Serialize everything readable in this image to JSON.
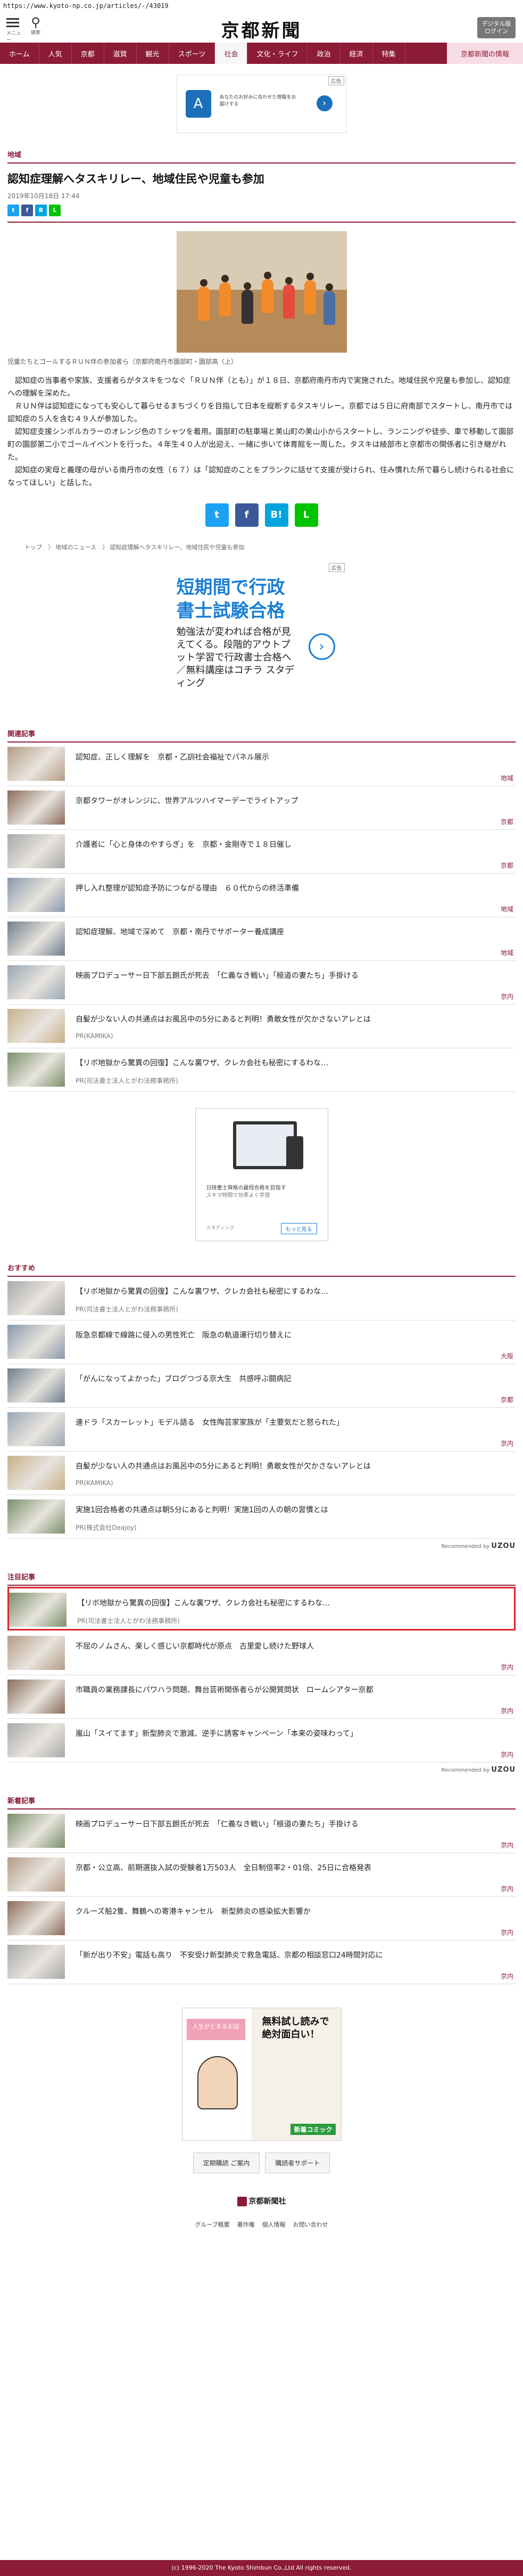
{
  "url": "https://www.kyoto-np.co.jp/articles/-/43019",
  "header": {
    "menu_label": "メニュー",
    "search_label": "検索",
    "logo_text": "京都新聞",
    "download_label_1": "デジタル版",
    "download_label_2": "ログイン"
  },
  "nav": {
    "items": [
      "ホーム",
      "人気",
      "京都",
      "滋賀",
      "観光",
      "スポーツ",
      "社会",
      "文化・ライフ",
      "政治",
      "経済",
      "特集"
    ],
    "active_index": 6,
    "special": "京都新聞の情報"
  },
  "top_ad": {
    "label": "広告",
    "text": "あなたのお好みに合わせた情報をお届けする"
  },
  "article": {
    "section": "地域",
    "headline": "認知症理解へタスキリレー、地域住民や児童も参加",
    "date": "2019年10月18日 17:44",
    "photo_caption": "児童たちとゴールするＲＵＮ伴の参加者ら（京都府南丹市園部町・園部高〈上）",
    "paragraphs": [
      "認知症の当事者や家族、支援者らがタスキをつなぐ「ＲＵＮ伴（とも）」が１８日、京都府南丹市内で実施された。地域住民や児童も参加し、認知症への理解を深めた。",
      "ＲＵＮ伴は認知症になっても安心して暮らせるまちづくりを目指して日本を縦断するタスキリレー。京都では５日に府南部でスタートし、南丹市では認知症の５人を含む４９人が参加した。",
      "認知症支援シンボルカラーのオレンジ色のＴシャツを着用。園部町の駐車場と美山町の美山小からスタートし、ランニングや徒歩、車で移動して園部町の園部第二小でゴールイベントを行った。４年生４０人が出迎え、一緒に歩いて体育館を一周した。タスキは綾部市と京都市の関係者に引き継がれた。",
      "認知症の実母と義理の母がいる南丹市の女性（６７）は「認知症のことをプランクに話せて支援が受けられ、住み慣れた所で暮らし続けられる社会になってほしい」と話した。"
    ]
  },
  "breadcrumb": "トップ　〉 地域のニュース　〉 認知症理解へタスキリレー、地域住民や児童も参加",
  "mid_ad": {
    "label": "広告",
    "headline_1": "短期間で行政",
    "headline_2": "書士試験合格",
    "body": "勉強法が変われば合格が見えてくる。段階的アウトプット学習で行政書士合格へ／無料講座はコチラ スタディング"
  },
  "related": {
    "title": "関連記事",
    "items": [
      {
        "title": "認知症、正しく理解を　京都・乙訓社会福祉でパネル展示",
        "tag": "地域"
      },
      {
        "title": "京都タワーがオレンジに、世界アルツハイマーデーでライトアップ",
        "tag": "京都"
      },
      {
        "title": "介護者に「心と身体のやすらぎ」を　京都・金剛寺で１８日催し",
        "tag": "京都"
      },
      {
        "title": "押し入れ整理が認知症予防につながる理由　６０代からの終活準備",
        "tag": "地域"
      },
      {
        "title": "認知症理解、地域で深めて　京都・南丹でサポーター養成講座",
        "tag": "地域"
      },
      {
        "title": "映画プロデューサー日下部五朗氏が死去　「仁義なき戦い」「極道の妻たち」手掛ける",
        "tag": "京内"
      },
      {
        "title": "自髪が少ない人の共通点はお風呂中の5分にあると判明！勇敢女性が欠かさないアレとは",
        "pr": "PR(KAMIKA)"
      },
      {
        "title": "【リボ地獄から驚異の回復】こんな裏ワザ、クレカ会社も秘密にするわな…",
        "pr": "PR(司法書士法人とがわ法務事務所)"
      }
    ]
  },
  "box_ad": {
    "line1": "日経書士資格の最短合格を目指す",
    "line2": "スキマ時間で効率よく学習",
    "brand": "スタディング",
    "cta": "もっと見る"
  },
  "recommend_list": {
    "title": "おすすめ",
    "items": [
      {
        "title": "【リボ地獄から驚異の回復】こんな裏ワザ、クレカ会社も秘密にするわな…",
        "pr": "PR(司法書士法人とがわ法務事務所)"
      },
      {
        "title": "阪急京都線で線路に侵入の男性死亡　阪急の軌道運行切り替えに",
        "tag": "大阪"
      },
      {
        "title": "「がんになってよかった」ブログつづる京大生　共感呼ぶ闘病記",
        "tag": "京都"
      },
      {
        "title": "連ドラ「スカーレット」モデル語る　女性陶芸家家族が「主要気だと怒られた」",
        "tag": "京内"
      },
      {
        "title": "自髪が少ない人の共通点はお風呂中の5分にあると判明！勇敢女性が欠かさないアレとは",
        "pr": "PR(KAMIKA)"
      },
      {
        "title": "実施1回合格者の共通点は朝5分にあると判明！実施1回の人の朝の習慣とは",
        "pr": "PR(株式会社Deajoy)"
      }
    ],
    "powered_label": "Recommended by",
    "powered_brand": "UZOU"
  },
  "pickup": {
    "title": "注目記事",
    "items": [
      {
        "title": "【リボ地獄から驚異の回復】こんな裏ワザ、クレカ会社も秘密にするわな…",
        "pr": "PR(司法書士法人とがわ法務事務所)"
      },
      {
        "title": "不屈のノムさん、楽しく感じい京都時代が原点　古里愛し続けた野球人",
        "tag": "京内"
      },
      {
        "title": "市職員の業務課長にパワハラ問題、舞台芸術関係者らが公開質問状　ロームシアター京都",
        "tag": "京内"
      },
      {
        "title": "嵐山「スイてます」新型肺炎で激減、逆手に誘客キャンペーン「本来の姿味わって」",
        "tag": "京内"
      }
    ],
    "powered_label": "Recommended by",
    "powered_brand": "UZOU"
  },
  "latest": {
    "title": "新着記事",
    "items": [
      {
        "title": "映画プロデューサー日下部五朗氏が死去　「仁義なき戦い」「極道の妻たち」手掛ける",
        "tag": "京内"
      },
      {
        "title": "京都・公立高、前期選抜入試の受験者1万503人　全日制倍率2・01倍、25日に合格発表",
        "tag": "京内"
      },
      {
        "title": "クルーズ船2隻、舞鶴への寄港キャンセル　新型肺炎の感染拡大影響か",
        "tag": "京内"
      },
      {
        "title": "「新が出り不安」電話も高り　不安受け新型肺炎で救急電話、京都の相談窓口24時間対応に",
        "tag": "京内"
      }
    ]
  },
  "bottom_ad": {
    "badge": "新着コミック",
    "pink_text": "人生がとまるお話",
    "right_text": "無料試し読みで絶対面白い！"
  },
  "footer": {
    "btn1": "定期購読 ご案内",
    "btn2": "購読者サポート",
    "logo": "京都新聞社",
    "links": [
      "グループ概要",
      "著作権",
      "個人情報",
      "お問い合わせ"
    ],
    "copyright": "(c) 1996-2020 The Kyoto Shimbun Co.,Ltd All rights reserved."
  },
  "colors": {
    "brand": "#8c1b36",
    "alert": "#e0222b",
    "twitter": "#1da1f2",
    "facebook": "#3b5998",
    "hatena": "#00a4de",
    "line": "#00c300"
  }
}
